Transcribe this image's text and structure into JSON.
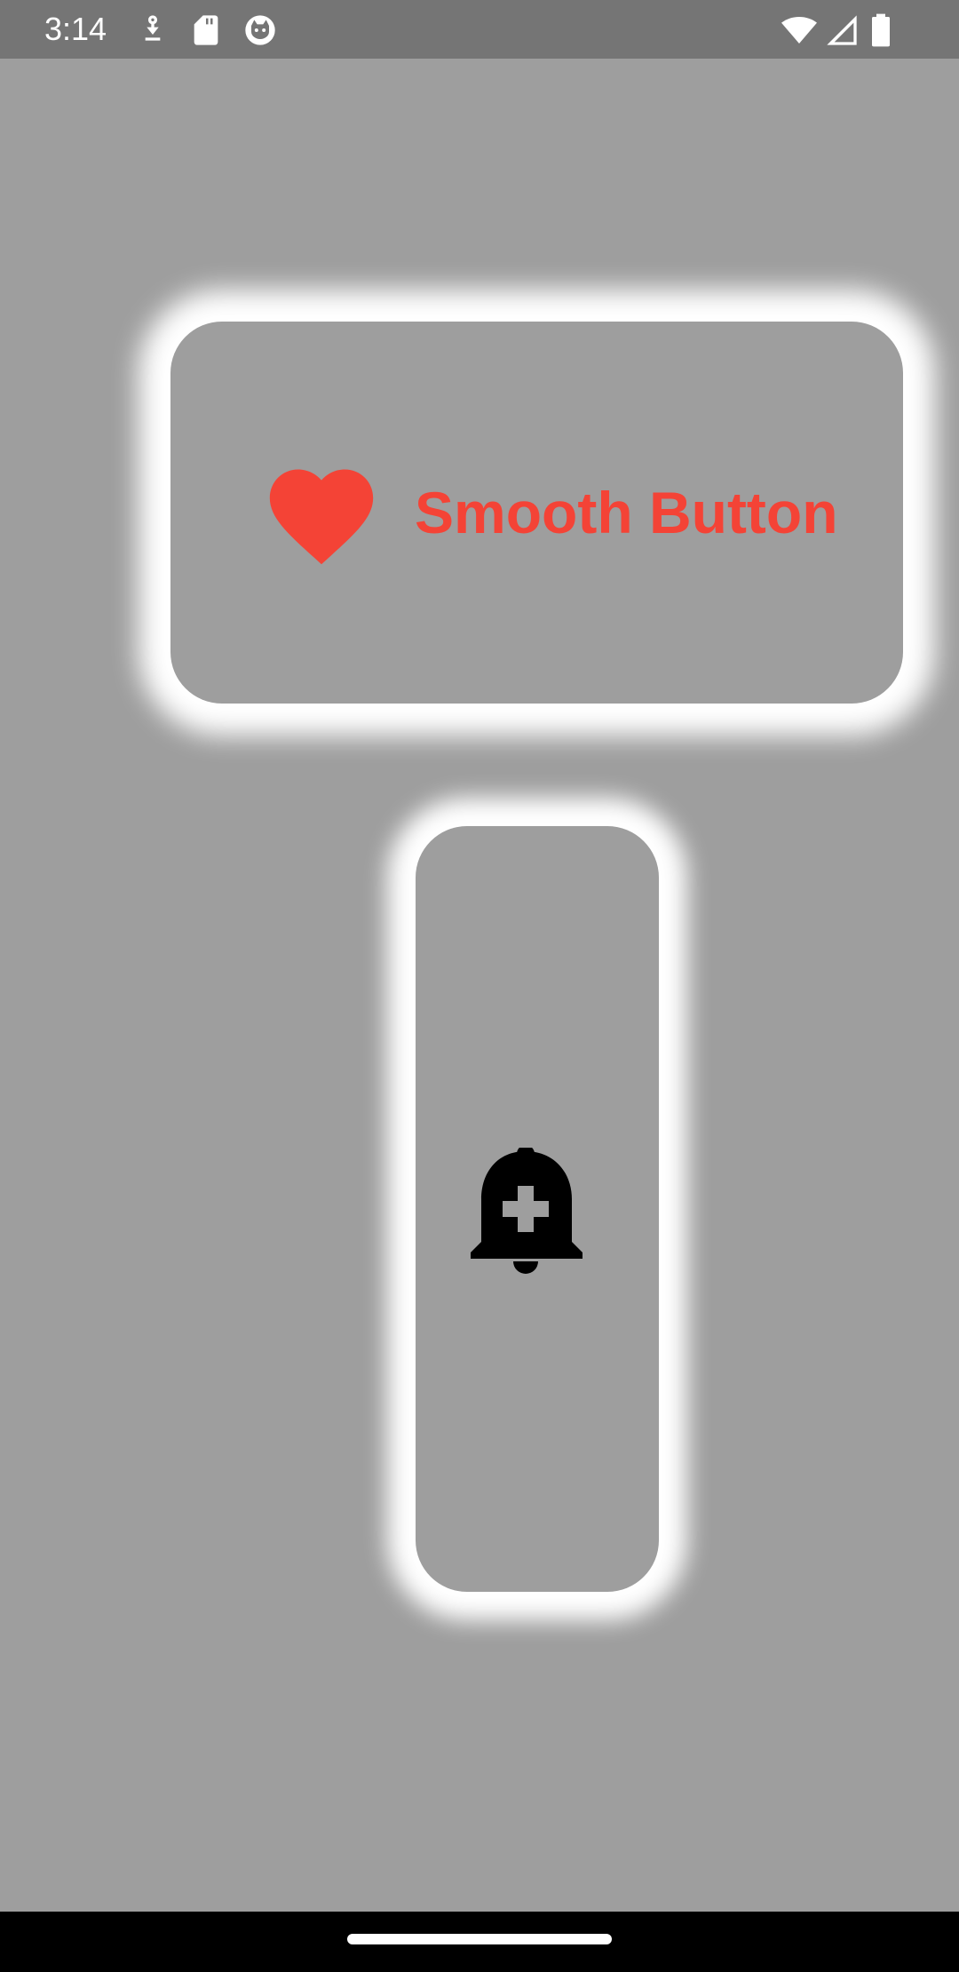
{
  "status_bar": {
    "time": "3:14",
    "left_icons": [
      "download-icon",
      "sd-card-icon",
      "cat-face-icon"
    ],
    "right_icons": [
      "wifi-icon",
      "cellular-signal-icon",
      "battery-icon"
    ]
  },
  "smooth_button": {
    "label": "Smooth Button",
    "icon": "heart-icon",
    "accent_color": "#f44336"
  },
  "bell_button": {
    "icon": "add-alert-bell-icon",
    "icon_color": "#000000"
  },
  "colors": {
    "background": "#9e9e9e",
    "status_bar": "#757575",
    "glow": "#ffffff",
    "nav_bar": "#000000"
  }
}
